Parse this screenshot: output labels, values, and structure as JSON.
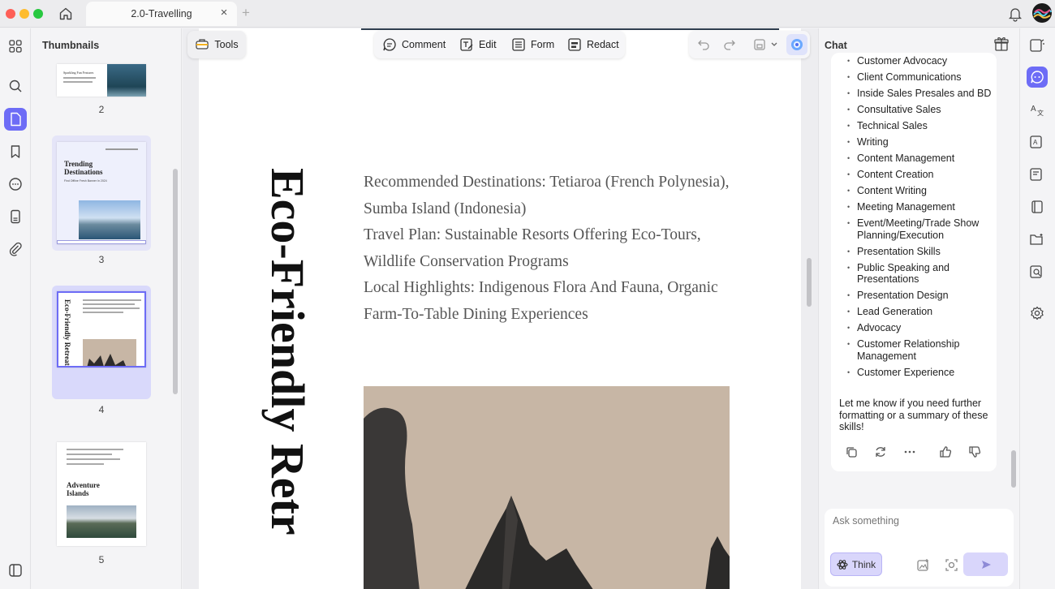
{
  "window": {
    "tab_title": "2.0-Travelling",
    "tab_close": "×",
    "tab_add": "+"
  },
  "panels": {
    "thumbnails_title": "Thumbnails",
    "chat_title": "Chat"
  },
  "thumbnails": [
    {
      "page": "2",
      "heading": "Sparkling Fun Features"
    },
    {
      "page": "3",
      "heading": "Trending Destinations",
      "subheading": "Find Offline Fresh Banner In 2024"
    },
    {
      "page": "4",
      "heading": "Eco-Friendly Retreats"
    },
    {
      "page": "5",
      "heading": "Adventure Islands"
    }
  ],
  "toolbar": {
    "tools_label": "Tools",
    "comment_label": "Comment",
    "edit_label": "Edit",
    "form_label": "Form",
    "redact_label": "Redact"
  },
  "document": {
    "vertical_title": "Eco-Friendly Retr",
    "lines": [
      "Recommended Destinations: Tetiaroa (French Polynesia),",
      "Sumba Island (Indonesia)",
      "Travel Plan: Sustainable Resorts Offering Eco-Tours,",
      "Wildlife Conservation Programs",
      "Local Highlights: Indigenous Flora And Fauna, Organic",
      "Farm-To-Table Dining Experiences"
    ]
  },
  "chat": {
    "skills": [
      "Customer Advocacy",
      "Client Communications",
      "Inside Sales Presales and BD",
      "Consultative Sales",
      "Technical Sales",
      "Writing",
      "Content Management",
      "Content Creation",
      "Content Writing",
      "Meeting Management",
      "Event/Meeting/Trade Show Planning/Execution",
      "Presentation Skills",
      "Public Speaking and Presentations",
      "Presentation Design",
      "Lead Generation",
      "Advocacy",
      "Customer Relationship Management",
      "Customer Experience"
    ],
    "closing_note": "Let me know if you need further formatting or a summary of these skills!",
    "input_placeholder": "Ask something",
    "think_label": "Think"
  },
  "colors": {
    "accent": "#6d6cf6",
    "accent_soft": "#d9d6fb"
  }
}
